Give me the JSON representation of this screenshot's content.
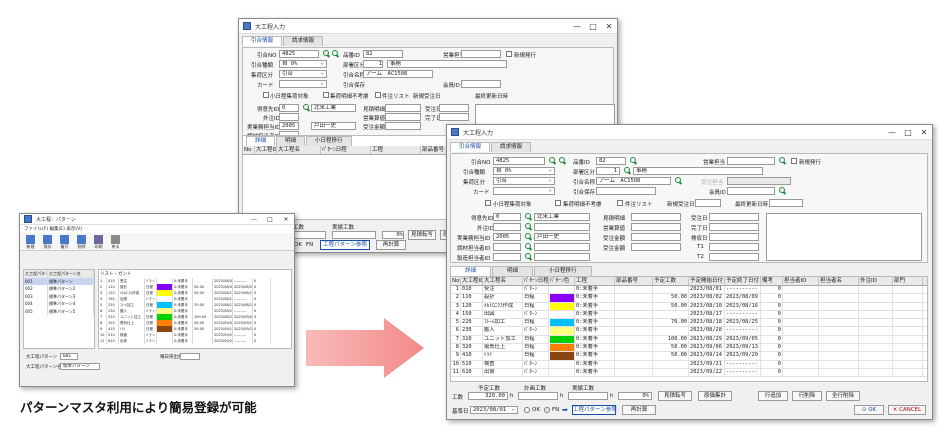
{
  "caption": "パターンマスタ利用により簡易登録が可能",
  "back_window": {
    "title": "大工程入力",
    "tabs": [
      "引合情報",
      "請求情報"
    ]
  },
  "small_window": {
    "title": "大工程：パターン",
    "menu": "ファイル(F)  編集(E)  表示(V)",
    "toolbar": [
      "新規",
      "保存",
      "複写",
      "削除",
      "印刷",
      "戻る"
    ],
    "left_headers": [
      "大工程パターン",
      "大工程パターン名"
    ],
    "left_rows": [
      [
        "001",
        "標準パターン"
      ],
      [
        "002",
        "標準パターン2"
      ],
      [
        "003",
        "標準パターン3"
      ],
      [
        "004",
        "標準パターン4"
      ],
      [
        "005",
        "標準パターン5"
      ]
    ],
    "right_title": "リスト・ガント",
    "footer_label1": "大工程パターン",
    "footer_label2": "大工程パターン名",
    "footer_value1": "001",
    "footer_value2": "標準パターン",
    "footer_label3": "曜日帯出色"
  },
  "main_window": {
    "title": "大工程入力",
    "tabs": [
      "引合情報",
      "請求情報"
    ],
    "form": {
      "hikiai_no_label": "引合NO",
      "hikiai_no": "4825",
      "hinban_label": "品番ID",
      "hinban": "82",
      "eigyo_label": "営業担当",
      "eigyo": "",
      "shinki_label": "新規発行",
      "hikiai_shubetsu_label": "引合種類",
      "hikiai_shubetsu": "自 0%",
      "busho_label": "部署区分",
      "busho_code": "1",
      "busho_name": "事務",
      "juchu_label": "集荷区分",
      "juchu": "引合",
      "hikiai_kubun_label": "引合名称",
      "hikiai_kubun": "アーム　AC1508",
      "kubun2_label": "受注担当",
      "kubun2": "",
      "card_label": "カード",
      "hikiai_hozon_label": "引合保存",
      "kaiin_label": "会員ID",
      "kaiin": "",
      "check1": "小日程集荷対象",
      "check2": "集荷明細不考慮",
      "check3": "件注リスト",
      "sanpo_label": "新規受注日",
      "saishu_label": "最終更新日時",
      "tokui_label": "得意先ID",
      "tokui_code": "0",
      "tokui_name": "北米工業",
      "gaibu_label": "外注ID",
      "gaibu": "",
      "eigyo_tanto_label": "実業務担当ID",
      "eigyo_tanto_code": "2005",
      "eigyo_tanto_name": "戸田一史",
      "seizo_label": "調材担当者ID",
      "seizo": "",
      "shizai_label": "製造担当者ID",
      "shizai": "",
      "mitsumori_label": "見積明細",
      "mitsumori": "",
      "eigyo_kin_label": "営業算値",
      "eigyo_kin": "",
      "juchu_kin_label": "受注金額",
      "juchu_kin": "",
      "jucho_label": "受注金額",
      "jucho": "",
      "juchu_date_label": "受注日",
      "juchu_date": "",
      "nouki_label": "完了日",
      "nouki": "",
      "nohin_label": "検収日",
      "nohin": "",
      "t1_label": "T1",
      "t2_label": "T2",
      "sub_tabs": [
        "詳細",
        "明細",
        "小日程移行"
      ]
    },
    "grid": {
      "headers": [
        "No",
        "大工程ID",
        "大工程名",
        "ﾊﾟﾀｰﾝ日程",
        "ﾊﾟﾀｰﾝ色",
        "工程",
        "部品番号",
        "予定工数",
        "予定開始日付",
        "予定終了日付",
        "備考",
        "担当者ID",
        "担当者名",
        "外注ID",
        "部門"
      ],
      "rows": [
        [
          "1",
          "010",
          "受注",
          "ﾊﾟﾀｰﾝ",
          "#ffffff",
          "0:未着手",
          "",
          "",
          "2023/08/01",
          "----------",
          "0",
          "",
          "",
          "",
          ""
        ],
        [
          "2",
          "110",
          "設計",
          "日程",
          "#8a00ff",
          "0:未着手",
          "",
          "50.00",
          "2023/08/02",
          "2023/08/09",
          "0",
          "",
          "",
          "",
          ""
        ],
        [
          "3",
          "120",
          "ﾒｶﾄﾛﾆｸｽ作成",
          "日程",
          "#ffff00",
          "0:未着手",
          "",
          "50.00",
          "2023/08/10",
          "2023/08/16",
          "0",
          "",
          "",
          "",
          ""
        ],
        [
          "4",
          "150",
          "出図",
          "ﾊﾟﾀｰﾝ",
          "#ffffff",
          "0:未着手",
          "",
          "",
          "2023/08/17",
          "----------",
          "0",
          "",
          "",
          "",
          ""
        ],
        [
          "5",
          "220",
          "ﾌﾚｰﾑ加工",
          "日程",
          "#00c0ff",
          "0:未着手",
          "",
          "70.00",
          "2023/08/18",
          "2023/08/25",
          "0",
          "",
          "",
          "",
          ""
        ],
        [
          "6",
          "230",
          "搬入",
          "ﾊﾟﾀｰﾝ",
          "#ffff80",
          "0:未着手",
          "",
          "",
          "2023/08/28",
          "----------",
          "0",
          "",
          "",
          "",
          ""
        ],
        [
          "7",
          "310",
          "ユニット加工",
          "日程",
          "#00d000",
          "0:未着手",
          "",
          "100.00",
          "2023/08/29",
          "2023/09/05",
          "0",
          "",
          "",
          "",
          ""
        ],
        [
          "8",
          "320",
          "電気仕上",
          "日程",
          "#ff8000",
          "0:未着手",
          "",
          "50.00",
          "2023/09/06",
          "2023/09/13",
          "0",
          "",
          "",
          "",
          ""
        ],
        [
          "9",
          "410",
          "ﾄﾗｲ",
          "日程",
          "#8b4513",
          "0:未着手",
          "",
          "50.00",
          "2023/09/14",
          "2023/09/20",
          "0",
          "",
          "",
          "",
          ""
        ],
        [
          "10",
          "510",
          "検査",
          "ﾊﾟﾀｰﾝ",
          "#ffffff",
          "0:未着手",
          "",
          "",
          "2023/09/21",
          "----------",
          "0",
          "",
          "",
          "",
          ""
        ],
        [
          "11",
          "610",
          "出荷",
          "ﾊﾟﾀｰﾝ",
          "#ffffff",
          "0:未着手",
          "",
          "",
          "2023/09/22",
          "----------",
          "0",
          "",
          "",
          "",
          ""
        ]
      ]
    },
    "footer": {
      "yotei_label": "予定工数",
      "yotei": "320.00",
      "jisseki_label": "計画工数",
      "jisseki": "",
      "jitsu_label": "実績工数",
      "jitsu": "",
      "h1": "h",
      "h2": "h",
      "h3": "h",
      "pct": "0%",
      "btn1": "見積転写",
      "btn2": "原価集計",
      "btn3": "行追加",
      "btn4": "行削除",
      "btn5": "全行削除",
      "kijun_label": "基準日",
      "kijun_date": "2023/08/01",
      "radio1": "OK",
      "radio2": "FN",
      "btn_pattern": "工程パターン参照",
      "btn_saikeisan": "再計算",
      "ok_label": "OK",
      "cancel_label": "CANCEL"
    }
  }
}
